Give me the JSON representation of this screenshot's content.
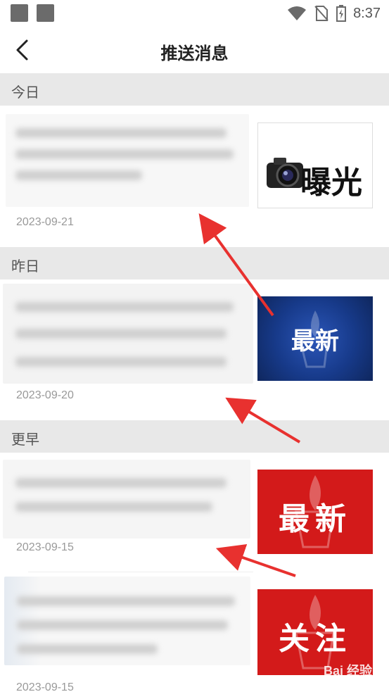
{
  "status_bar": {
    "time": "8:37",
    "icons": [
      "notification-square-icon",
      "notification-square-icon",
      "wifi-icon",
      "no-sim-icon",
      "battery-charging-icon"
    ]
  },
  "header": {
    "title": "推送消息",
    "back_icon": "chevron-left-icon"
  },
  "sections": {
    "today": "今日",
    "yesterday": "昨日",
    "earlier": "更早"
  },
  "messages": [
    {
      "date": "2023-09-21",
      "thumb_text": "曝光",
      "thumb_icon": "camera-icon"
    },
    {
      "date": "2023-09-20",
      "thumb_text": "最新"
    },
    {
      "date": "2023-09-15",
      "thumb_text": "最新"
    },
    {
      "date": "2023-09-15",
      "thumb_text": "关注"
    }
  ],
  "watermark": "Bai 经验",
  "colors": {
    "annotation_arrow": "#e8312f",
    "thumb_blue": "#1a3a8a",
    "thumb_red": "#d31a1a",
    "section_bg": "#e8e8e8"
  }
}
